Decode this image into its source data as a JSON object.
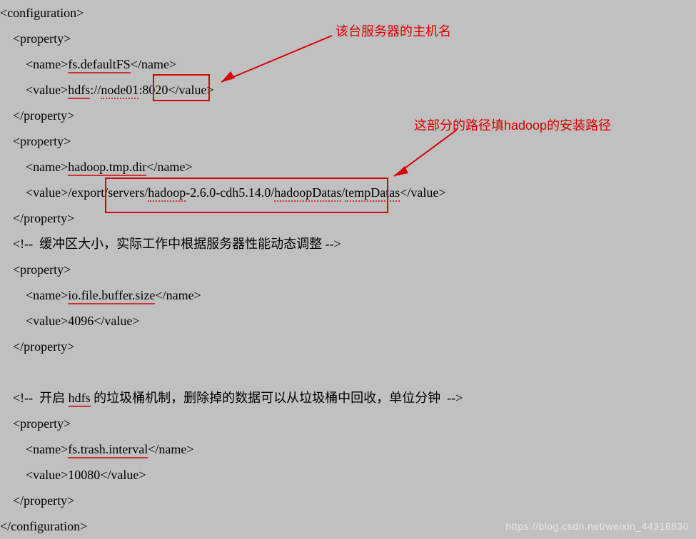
{
  "code": {
    "l1": "<configuration>",
    "l2a": "    <property>",
    "l3a": "        <name>",
    "l3b": "fs.defaultFS",
    "l3c": "</name>",
    "l4a": "        <value>",
    "l4b": "hdfs",
    "l4c": "://",
    "l4d": "node01",
    "l4e": ":8020</value>",
    "l5a": "    </property>",
    "l6a": "    <property>",
    "l7a": "        <name>",
    "l7b": "hadoop.tmp.dir",
    "l7c": "</name>",
    "l8a": "        <value>",
    "l8b": "/export/servers/",
    "l8c": "hadoop",
    "l8d": "-2.6.0-cdh5.14.0/",
    "l8e": "hadoopDatas",
    "l8f": "/",
    "l8g": "tempDatas",
    "l8h": "</value>",
    "l9a": "    </property>",
    "l10": "    <!--  缓冲区大小，实际工作中根据服务器性能动态调整 -->",
    "l11a": "    <property>",
    "l12a": "        <name>",
    "l12b": "io.file.buffer.size",
    "l12c": "</name>",
    "l13a": "        <value>4096</value>",
    "l14a": "    </property>",
    "blank": " ",
    "l15": "    <!--  开启 ",
    "l15b": "hdfs",
    "l15c": " 的垃圾桶机制，删除掉的数据可以从垃圾桶中回收，单位分钟  -->",
    "l16a": "    <property>",
    "l17a": "        <name>",
    "l17b": "fs.trash.interval",
    "l17c": "</name>",
    "l18a": "        <value>10080</value>",
    "l19a": "    </property>",
    "l20": "</configuration>"
  },
  "annotations": {
    "a1": "该台服务器的主机名",
    "a2": "这部分的路径填hadoop的安装路径"
  },
  "watermark": "https://blog.csdn.net/weixin_44318830"
}
